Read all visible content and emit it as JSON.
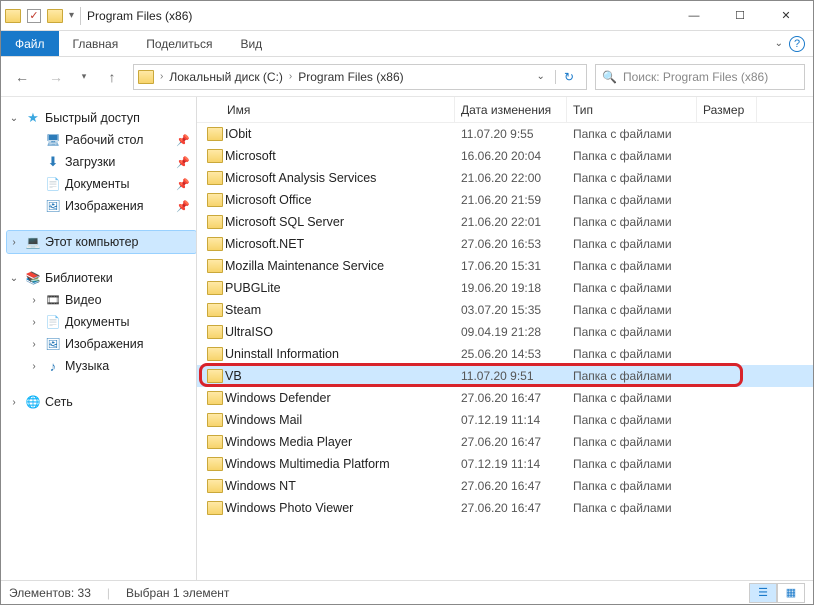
{
  "window": {
    "title": "Program Files (x86)"
  },
  "titlebar_controls": {
    "min": "—",
    "max": "☐",
    "close": "✕"
  },
  "ribbon": {
    "file": "Файл",
    "home": "Главная",
    "share": "Поделиться",
    "view": "Вид"
  },
  "addr": {
    "crumb1": "Локальный диск (C:)",
    "crumb2": "Program Files (x86)"
  },
  "search": {
    "placeholder": "Поиск: Program Files (x86)"
  },
  "nav": {
    "quick": "Быстрый доступ",
    "desktop": "Рабочий стол",
    "downloads": "Загрузки",
    "documents": "Документы",
    "pictures": "Изображения",
    "thispc": "Этот компьютер",
    "libraries": "Библиотеки",
    "videos": "Видео",
    "documents2": "Документы",
    "pictures2": "Изображения",
    "music": "Музыка",
    "network": "Сеть"
  },
  "columns": {
    "name": "Имя",
    "date": "Дата изменения",
    "type": "Тип",
    "size": "Размер"
  },
  "files": [
    {
      "name": "IObit",
      "date": "11.07.20 9:55",
      "type": "Папка с файлами"
    },
    {
      "name": "Microsoft",
      "date": "16.06.20 20:04",
      "type": "Папка с файлами"
    },
    {
      "name": "Microsoft Analysis Services",
      "date": "21.06.20 22:00",
      "type": "Папка с файлами"
    },
    {
      "name": "Microsoft Office",
      "date": "21.06.20 21:59",
      "type": "Папка с файлами"
    },
    {
      "name": "Microsoft SQL Server",
      "date": "21.06.20 22:01",
      "type": "Папка с файлами"
    },
    {
      "name": "Microsoft.NET",
      "date": "27.06.20 16:53",
      "type": "Папка с файлами"
    },
    {
      "name": "Mozilla Maintenance Service",
      "date": "17.06.20 15:31",
      "type": "Папка с файлами"
    },
    {
      "name": "PUBGLite",
      "date": "19.06.20 19:18",
      "type": "Папка с файлами"
    },
    {
      "name": "Steam",
      "date": "03.07.20 15:35",
      "type": "Папка с файлами"
    },
    {
      "name": "UltraISO",
      "date": "09.04.19 21:28",
      "type": "Папка с файлами"
    },
    {
      "name": "Uninstall Information",
      "date": "25.06.20 14:53",
      "type": "Папка с файлами"
    },
    {
      "name": "VB",
      "date": "11.07.20 9:51",
      "type": "Папка с файлами",
      "selected": true,
      "highlight": true
    },
    {
      "name": "Windows Defender",
      "date": "27.06.20 16:47",
      "type": "Папка с файлами"
    },
    {
      "name": "Windows Mail",
      "date": "07.12.19 11:14",
      "type": "Папка с файлами"
    },
    {
      "name": "Windows Media Player",
      "date": "27.06.20 16:47",
      "type": "Папка с файлами"
    },
    {
      "name": "Windows Multimedia Platform",
      "date": "07.12.19 11:14",
      "type": "Папка с файлами"
    },
    {
      "name": "Windows NT",
      "date": "27.06.20 16:47",
      "type": "Папка с файлами"
    },
    {
      "name": "Windows Photo Viewer",
      "date": "27.06.20 16:47",
      "type": "Папка с файлами"
    }
  ],
  "status": {
    "count": "Элементов: 33",
    "selected": "Выбран 1 элемент"
  }
}
